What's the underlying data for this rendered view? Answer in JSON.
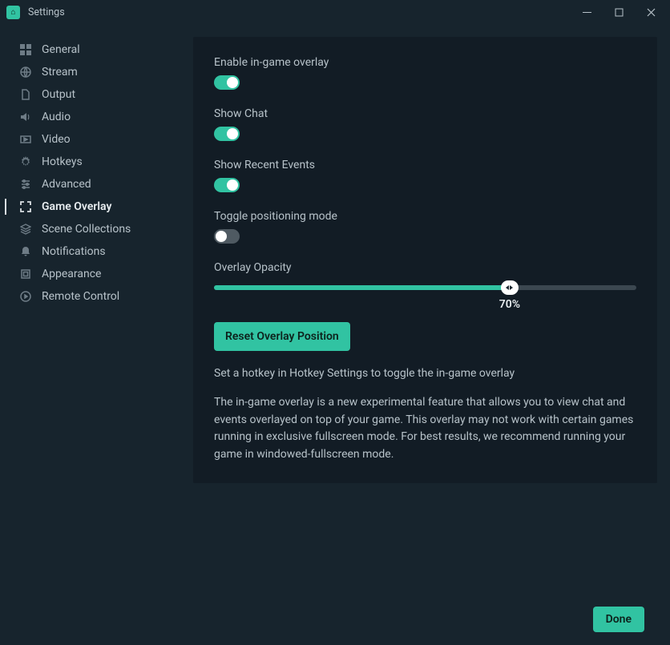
{
  "window": {
    "title": "Settings"
  },
  "sidebar": {
    "items": [
      {
        "label": "General",
        "icon": "grid-icon"
      },
      {
        "label": "Stream",
        "icon": "globe-icon"
      },
      {
        "label": "Output",
        "icon": "file-icon"
      },
      {
        "label": "Audio",
        "icon": "volume-icon"
      },
      {
        "label": "Video",
        "icon": "video-icon"
      },
      {
        "label": "Hotkeys",
        "icon": "gear-icon"
      },
      {
        "label": "Advanced",
        "icon": "sliders-icon"
      },
      {
        "label": "Game Overlay",
        "icon": "expand-icon",
        "active": true
      },
      {
        "label": "Scene Collections",
        "icon": "layers-icon"
      },
      {
        "label": "Notifications",
        "icon": "bell-icon"
      },
      {
        "label": "Appearance",
        "icon": "square-icon"
      },
      {
        "label": "Remote Control",
        "icon": "play-circle-icon"
      }
    ]
  },
  "overlay": {
    "enable_label": "Enable in-game overlay",
    "enable_on": true,
    "chat_label": "Show Chat",
    "chat_on": true,
    "events_label": "Show Recent Events",
    "events_on": true,
    "position_label": "Toggle positioning mode",
    "position_on": false,
    "opacity_label": "Overlay Opacity",
    "opacity_value": 70,
    "opacity_display": "70%",
    "reset_button": "Reset Overlay Position",
    "hint": "Set a hotkey in Hotkey Settings to toggle the in-game overlay",
    "description": "The in-game overlay is a new experimental feature that allows you to view chat and events overlayed on top of your game. This overlay may not work with certain games running in exclusive fullscreen mode. For best results, we recommend running your game in windowed-fullscreen mode."
  },
  "footer": {
    "done": "Done"
  }
}
